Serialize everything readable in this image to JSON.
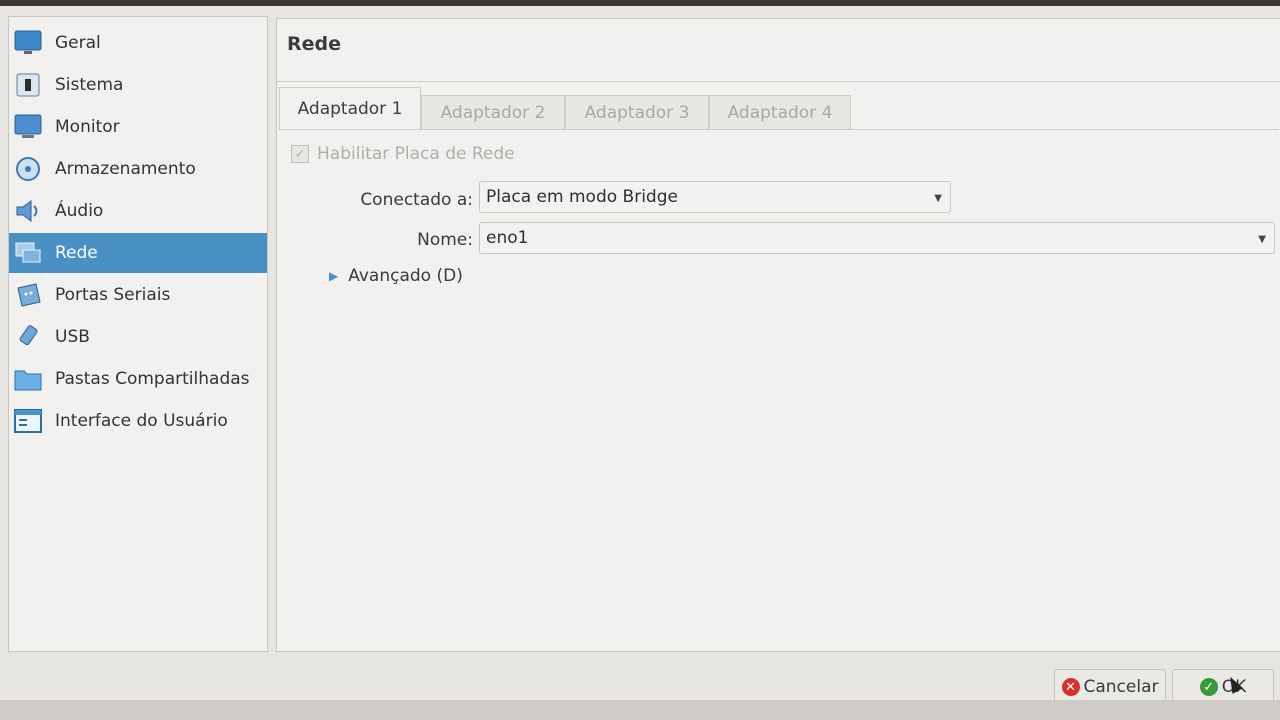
{
  "sidebar": {
    "items": [
      {
        "label": "Geral",
        "icon": "monitor-blue-icon"
      },
      {
        "label": "Sistema",
        "icon": "chip-icon"
      },
      {
        "label": "Monitor",
        "icon": "display-icon"
      },
      {
        "label": "Armazenamento",
        "icon": "disk-icon"
      },
      {
        "label": "Áudio",
        "icon": "speaker-icon"
      },
      {
        "label": "Rede",
        "icon": "network-icon",
        "selected": true
      },
      {
        "label": "Portas Seriais",
        "icon": "serial-port-icon"
      },
      {
        "label": "USB",
        "icon": "usb-icon"
      },
      {
        "label": "Pastas Compartilhadas",
        "icon": "folder-icon"
      },
      {
        "label": "Interface do Usuário",
        "icon": "window-icon"
      }
    ]
  },
  "main": {
    "title": "Rede",
    "tabs": [
      {
        "label": "Adaptador 1",
        "active": true
      },
      {
        "label": "Adaptador 2"
      },
      {
        "label": "Adaptador 3"
      },
      {
        "label": "Adaptador 4"
      }
    ],
    "enable_checkbox": {
      "label": "Habilitar Placa de Rede",
      "checked": true,
      "enabled": false
    },
    "attached_to": {
      "label": "Conectado a:",
      "value": "Placa em modo Bridge"
    },
    "name": {
      "label": "Nome:",
      "value": "eno1"
    },
    "advanced": {
      "label": "Avançado (D)"
    }
  },
  "buttons": {
    "cancel_label": "Cancelar",
    "ok_label": "OK"
  },
  "colors": {
    "selection": "#4a90c4",
    "cancel_icon": "#d9302c",
    "ok_icon": "#3a9a3a",
    "accent": "#4a8fcf"
  }
}
